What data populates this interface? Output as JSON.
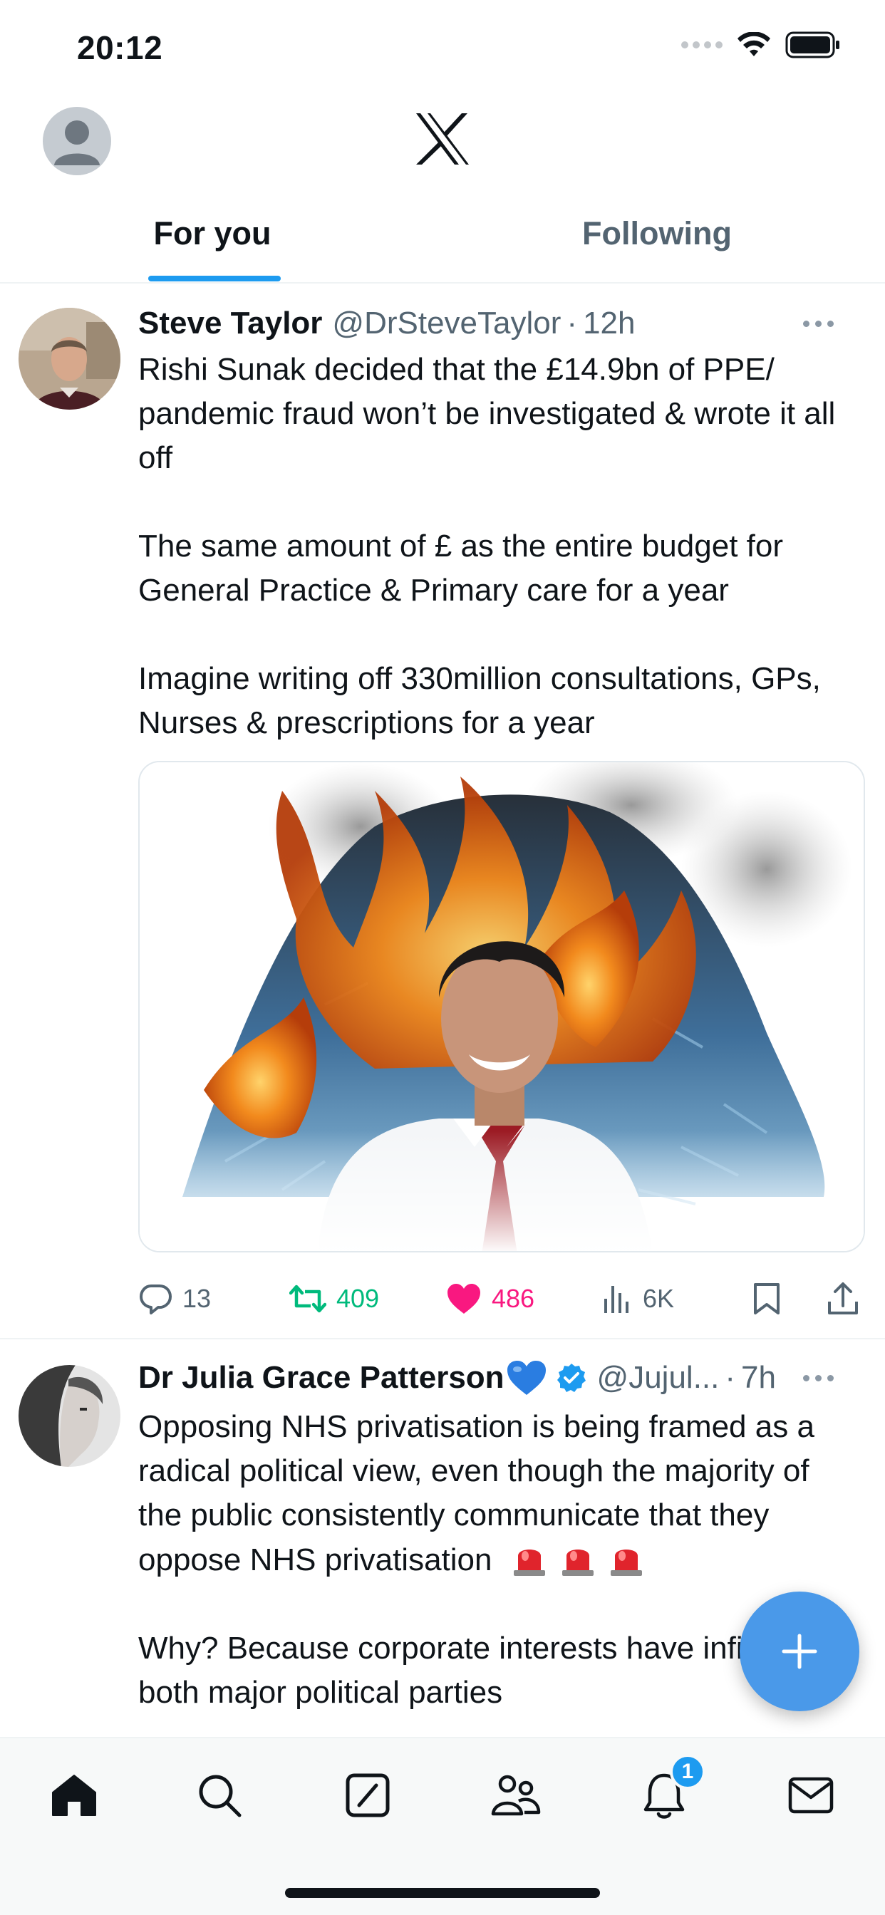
{
  "status_bar": {
    "time": "20:12"
  },
  "header": {
    "logo": "x-logo",
    "tabs": [
      {
        "label": "For you",
        "active": true
      },
      {
        "label": "Following",
        "active": false
      }
    ]
  },
  "feed": {
    "tweets": [
      {
        "display_name": "Steve Taylor",
        "handle": "@DrSteveTaylor",
        "separator": "·",
        "time": "12h",
        "paragraphs": [
          "Rishi Sunak decided that the £14.9bn of PPE/ pandemic fraud won’t be investigated & wrote it all off",
          "The same amount of £ as the entire budget for General Practice & Primary care for a year",
          "Imagine writing off 330million consultations, GPs, Nurses & prescriptions for a year"
        ],
        "media": "image of a smiling man in white shirt and red tie in front of a burning pile of face masks",
        "actions": {
          "replies": "13",
          "retweets": "409",
          "likes": "486",
          "views": "6K"
        }
      },
      {
        "display_name": "Dr Julia Grace Patterson",
        "handle": "@Jujul...",
        "separator": "·",
        "time": "7h",
        "verified": true,
        "paragraphs": [
          "Opposing NHS privatisation is being framed as a radical political view, even though the majority of the public consistently communicate that they oppose NHS privatisation",
          "Why? Because corporate interests have infiltrated both major political parties"
        ]
      }
    ]
  },
  "notifications_badge": "1",
  "colors": {
    "accent": "#1d9bf0",
    "retweet": "#00ba7c",
    "like": "#f91880",
    "secondary_text": "#536471",
    "fab": "#4a99e9"
  },
  "icons": {
    "nav": [
      "home-icon",
      "search-icon",
      "grok-icon",
      "communities-icon",
      "bell-icon",
      "mail-icon"
    ],
    "tweet_actions": [
      "reply-icon",
      "retweet-icon",
      "heart-icon",
      "views-icon",
      "bookmark-icon",
      "share-icon"
    ]
  }
}
